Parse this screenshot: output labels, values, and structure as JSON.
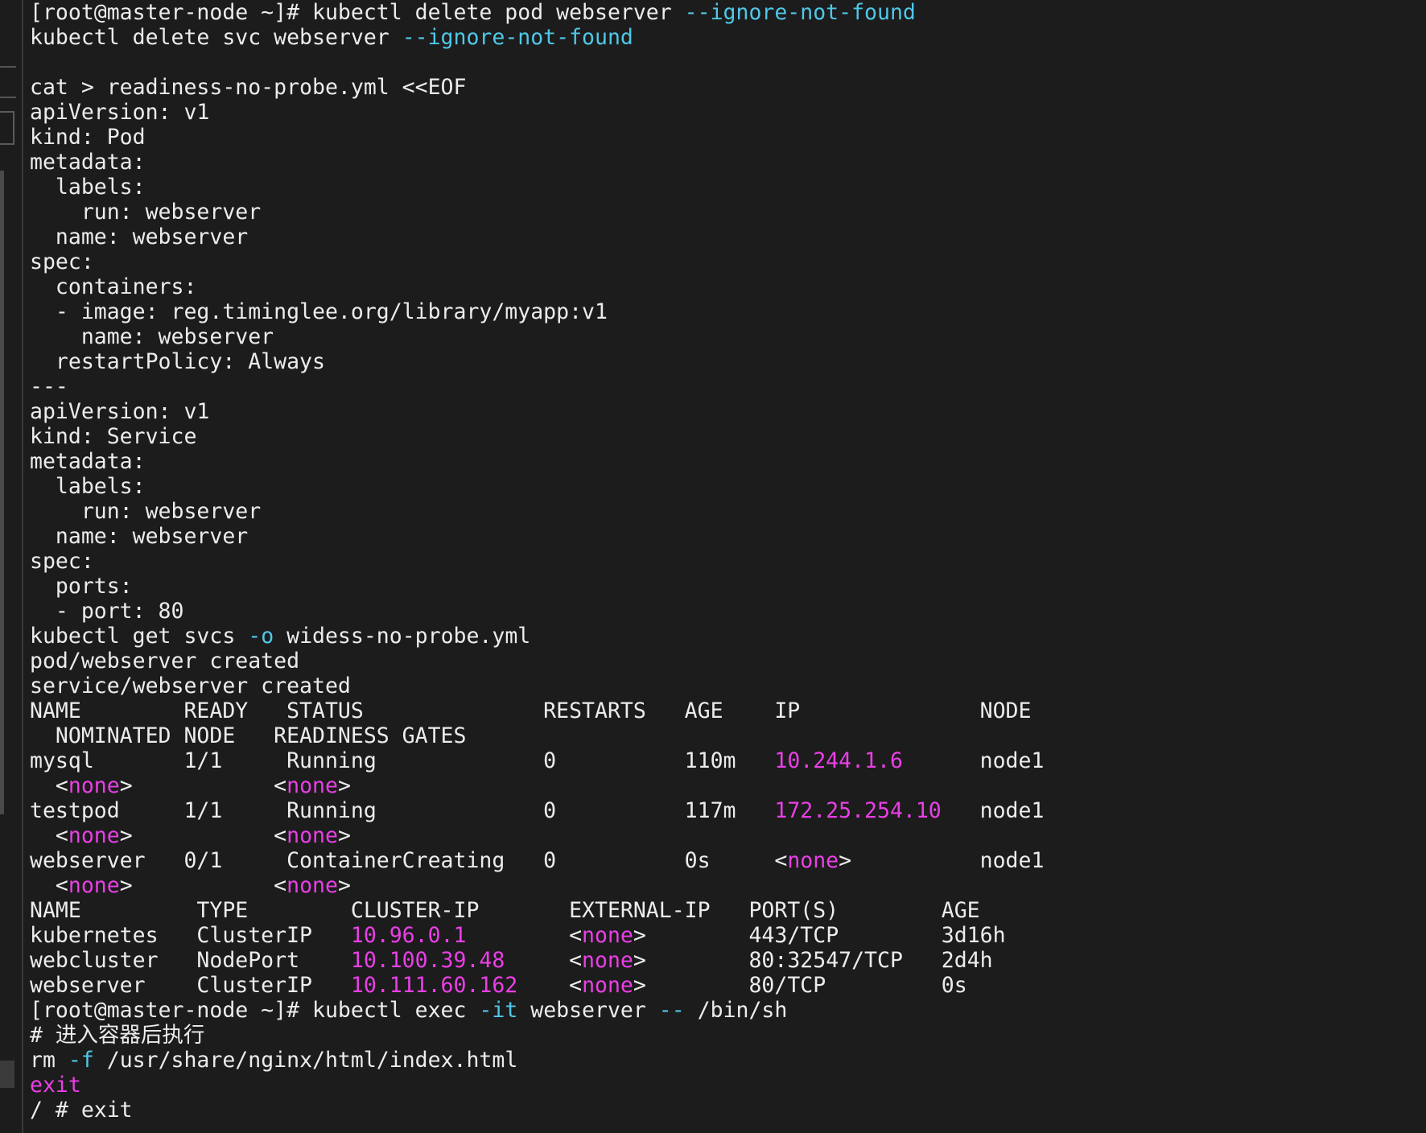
{
  "colors": {
    "background": "#1c1c1c",
    "text": "#ececec",
    "option_cyan": "#4fc8e8",
    "value_magenta": "#ea3fe6"
  },
  "terminal": {
    "lines": [
      [
        {
          "t": "[root@master-node ~]# kubectl delete pod webserver "
        },
        {
          "t": "--ignore-not-found",
          "c": "cy"
        }
      ],
      [
        {
          "t": "kubectl delete svc webserver "
        },
        {
          "t": "--ignore-not-found",
          "c": "cy"
        }
      ],
      [
        {
          "t": ""
        }
      ],
      [
        {
          "t": "cat > readiness-no-probe.yml <<EOF"
        }
      ],
      [
        {
          "t": "apiVersion: v1"
        }
      ],
      [
        {
          "t": "kind: Pod"
        }
      ],
      [
        {
          "t": "metadata:"
        }
      ],
      [
        {
          "t": "  labels:"
        }
      ],
      [
        {
          "t": "    run: webserver"
        }
      ],
      [
        {
          "t": "  name: webserver"
        }
      ],
      [
        {
          "t": "spec:"
        }
      ],
      [
        {
          "t": "  containers:"
        }
      ],
      [
        {
          "t": "  - image: reg.timinglee.org/library/myapp:v1"
        }
      ],
      [
        {
          "t": "    name: webserver"
        }
      ],
      [
        {
          "t": "  restartPolicy: Always"
        }
      ],
      [
        {
          "t": "---"
        }
      ],
      [
        {
          "t": "apiVersion: v1"
        }
      ],
      [
        {
          "t": "kind: Service"
        }
      ],
      [
        {
          "t": "metadata:"
        }
      ],
      [
        {
          "t": "  labels:"
        }
      ],
      [
        {
          "t": "    run: webserver"
        }
      ],
      [
        {
          "t": "  name: webserver"
        }
      ],
      [
        {
          "t": "spec:"
        }
      ],
      [
        {
          "t": "  ports:"
        }
      ],
      [
        {
          "t": "  - port: 80"
        }
      ],
      [
        {
          "t": "kubectl get svcs "
        },
        {
          "t": "-o",
          "c": "cy"
        },
        {
          "t": " widess-no-probe.yml"
        }
      ],
      [
        {
          "t": "pod/webserver created"
        }
      ],
      [
        {
          "t": "service/webserver created"
        }
      ],
      [
        {
          "t": "NAME        READY   STATUS              RESTARTS   AGE    IP              NODE"
        }
      ],
      [
        {
          "t": "  NOMINATED NODE   READINESS GATES"
        }
      ],
      [
        {
          "t": "mysql       1/1     Running             0          110m   "
        },
        {
          "t": "10.244.1.6",
          "c": "mg"
        },
        {
          "t": "      node1"
        }
      ],
      [
        {
          "t": "  <"
        },
        {
          "t": "none",
          "c": "mg"
        },
        {
          "t": ">           <"
        },
        {
          "t": "none",
          "c": "mg"
        },
        {
          "t": ">"
        }
      ],
      [
        {
          "t": "testpod     1/1     Running             0          117m   "
        },
        {
          "t": "172.25.254.10",
          "c": "mg"
        },
        {
          "t": "   node1"
        }
      ],
      [
        {
          "t": "  <"
        },
        {
          "t": "none",
          "c": "mg"
        },
        {
          "t": ">           <"
        },
        {
          "t": "none",
          "c": "mg"
        },
        {
          "t": ">"
        }
      ],
      [
        {
          "t": "webserver   0/1     ContainerCreating   0          0s     <"
        },
        {
          "t": "none",
          "c": "mg"
        },
        {
          "t": ">          node1"
        }
      ],
      [
        {
          "t": "  <"
        },
        {
          "t": "none",
          "c": "mg"
        },
        {
          "t": ">           <"
        },
        {
          "t": "none",
          "c": "mg"
        },
        {
          "t": ">"
        }
      ],
      [
        {
          "t": "NAME         TYPE        CLUSTER-IP       EXTERNAL-IP   PORT(S)        AGE"
        }
      ],
      [
        {
          "t": "kubernetes   ClusterIP   "
        },
        {
          "t": "10.96.0.1",
          "c": "mg"
        },
        {
          "t": "        <"
        },
        {
          "t": "none",
          "c": "mg"
        },
        {
          "t": ">        443/TCP        3d16h"
        }
      ],
      [
        {
          "t": "webcluster   NodePort    "
        },
        {
          "t": "10.100.39.48",
          "c": "mg"
        },
        {
          "t": "     <"
        },
        {
          "t": "none",
          "c": "mg"
        },
        {
          "t": ">        80:32547/TCP   2d4h"
        }
      ],
      [
        {
          "t": "webserver    ClusterIP   "
        },
        {
          "t": "10.111.60.162",
          "c": "mg"
        },
        {
          "t": "    <"
        },
        {
          "t": "none",
          "c": "mg"
        },
        {
          "t": ">        80/TCP         0s"
        }
      ],
      [
        {
          "t": "[root@master-node ~]# kubectl exec "
        },
        {
          "t": "-it",
          "c": "cy"
        },
        {
          "t": " webserver "
        },
        {
          "t": "--",
          "c": "cy"
        },
        {
          "t": " /bin/sh"
        }
      ],
      [
        {
          "t": "# 进入容器后执行"
        }
      ],
      [
        {
          "t": "rm "
        },
        {
          "t": "-f",
          "c": "cy"
        },
        {
          "t": " /usr/share/nginx/html/index.html"
        }
      ],
      [
        {
          "t": "exit",
          "c": "mg"
        }
      ],
      [
        {
          "t": "/ # exit"
        }
      ]
    ]
  }
}
